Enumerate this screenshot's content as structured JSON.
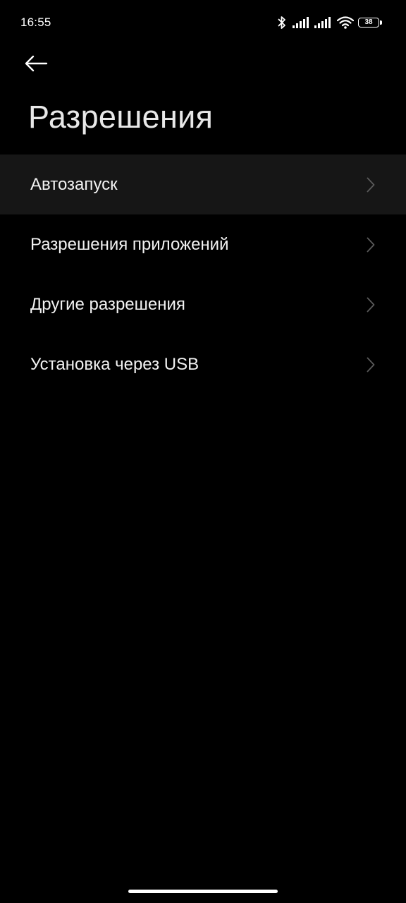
{
  "status_bar": {
    "time": "16:55",
    "icons": [
      "bluetooth-icon",
      "signal-icon",
      "signal-icon",
      "wifi-icon",
      "battery-icon"
    ],
    "battery_level": "38"
  },
  "header": {
    "back_icon": "arrow-left-icon",
    "title": "Разрешения"
  },
  "menu": {
    "items": [
      {
        "label": "Автозапуск",
        "icon": "chevron-right-icon",
        "highlighted": true
      },
      {
        "label": "Разрешения приложений",
        "icon": "chevron-right-icon",
        "highlighted": false
      },
      {
        "label": "Другие разрешения",
        "icon": "chevron-right-icon",
        "highlighted": false
      },
      {
        "label": "Установка через USB",
        "icon": "chevron-right-icon",
        "highlighted": false
      }
    ]
  },
  "colors": {
    "background": "#000000",
    "highlight_row": "#161616",
    "text": "#f2f2f2",
    "chevron": "#5a5a5a"
  }
}
